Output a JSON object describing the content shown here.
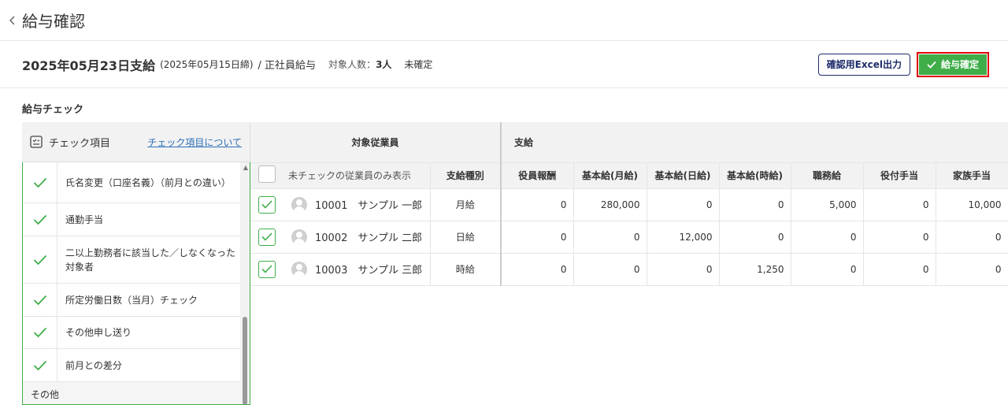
{
  "header": {
    "title": "給与確認"
  },
  "info": {
    "pay_date": "2025年05月23日支給",
    "close_date": "(2025年05月15日締)",
    "pay_type": "/ 正社員給与",
    "count_label": "対象人数：",
    "count_value": "3人",
    "status": "未確定",
    "excel_button": "確認用Excel出力",
    "confirm_button": "給与確定"
  },
  "check": {
    "section_title": "給与チェック",
    "header_label": "チェック項目",
    "header_link": "チェック項目について",
    "items": [
      {
        "label": "氏名変更（口座名義）（前月との違い）"
      },
      {
        "label": "通勤手当"
      },
      {
        "label": "二以上勤務者に該当した／しなくなった対象者"
      },
      {
        "label": "所定労働日数（当月）チェック"
      },
      {
        "label": "その他申し送り"
      },
      {
        "label": "前月との差分"
      }
    ],
    "other_label": "その他"
  },
  "grid": {
    "group_employee": "対象従業員",
    "group_payment": "支給",
    "filter_label": "未チェックの従業員のみ表示",
    "columns": [
      "支給種別",
      "役員報酬",
      "基本給(月給)",
      "基本給(日給)",
      "基本給(時給)",
      "職務給",
      "役付手当",
      "家族手当"
    ],
    "rows": [
      {
        "name": "10001　サンプル 一郎",
        "cells": [
          "月給",
          "0",
          "280,000",
          "0",
          "0",
          "5,000",
          "0",
          "10,000"
        ]
      },
      {
        "name": "10002　サンプル 二郎",
        "cells": [
          "日給",
          "0",
          "0",
          "12,000",
          "0",
          "0",
          "0",
          "0"
        ]
      },
      {
        "name": "10003　サンプル 三郎",
        "cells": [
          "時給",
          "0",
          "0",
          "0",
          "1,250",
          "0",
          "0",
          "0"
        ]
      }
    ]
  },
  "colors": {
    "accent_green": "#3fae49",
    "navy": "#1f2d6b",
    "highlight_red": "#e00000",
    "link_blue": "#2a6fb8"
  },
  "icons": {
    "back": "chevron-left-icon",
    "checklist": "checklist-icon",
    "check": "check-icon",
    "avatar": "user-avatar-icon"
  }
}
